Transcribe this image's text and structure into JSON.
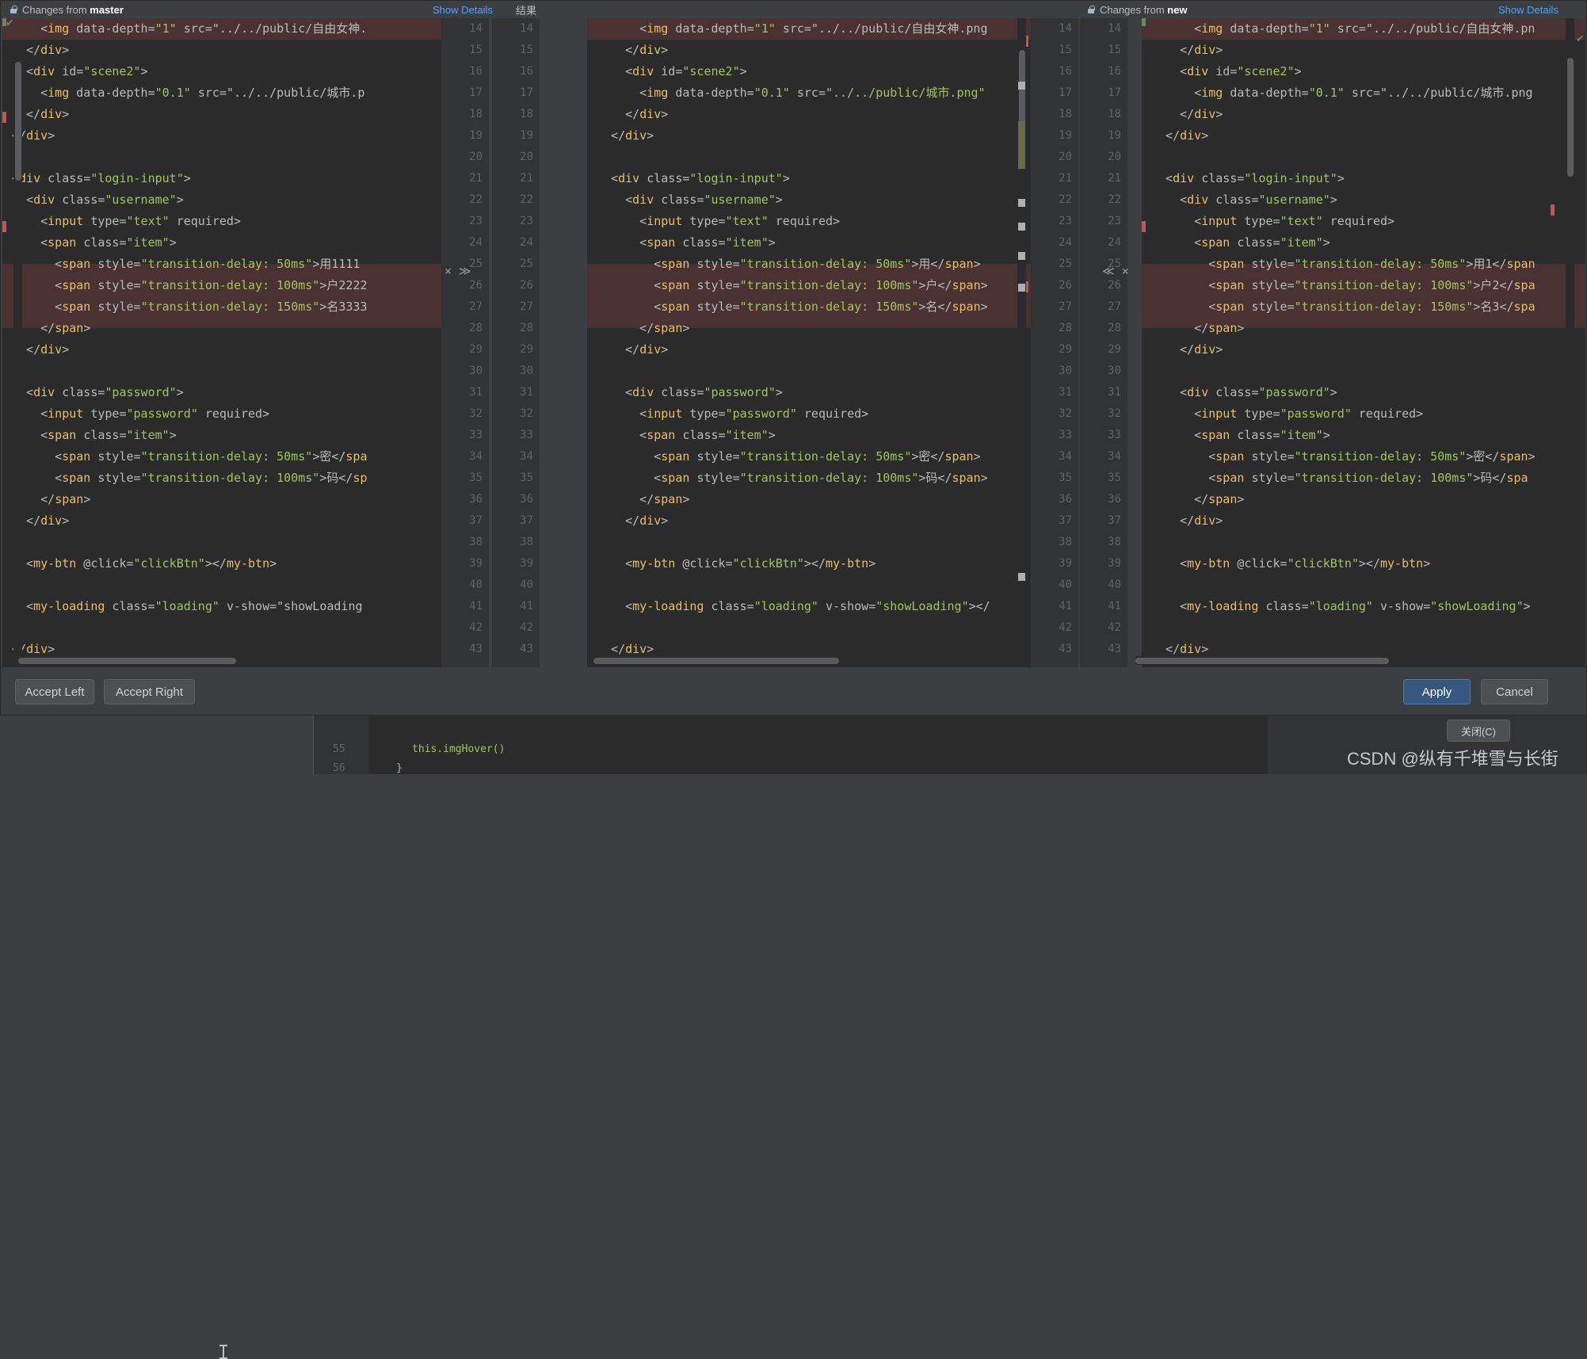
{
  "dialog": {
    "left_title_prefix": "Changes from ",
    "left_title_ref": "master",
    "right_title_prefix": "Changes from ",
    "right_title_ref": "new",
    "show_details_left": "Show Details",
    "show_details_right": "Show Details",
    "result_label": "结果",
    "buttons": {
      "accept_left": "Accept Left",
      "accept_right": "Accept Right",
      "apply": "Apply",
      "cancel": "Cancel"
    },
    "accent_primary": "#365880",
    "link_color": "#589df6"
  },
  "background": {
    "close_button": "关闭(C)",
    "watermark": "CSDN @纵有千堆雪与长街",
    "code_lines": [
      {
        "num": "55",
        "text": "this.imgHover()"
      },
      {
        "num": "56",
        "text": "}"
      }
    ]
  },
  "gutters": {
    "left_numbers": [
      "14",
      "15",
      "16",
      "17",
      "18",
      "19",
      "20",
      "21",
      "22",
      "23",
      "24",
      "25",
      "26",
      "27",
      "28",
      "29",
      "30",
      "31",
      "32",
      "33",
      "34",
      "35",
      "36",
      "37",
      "38",
      "39",
      "40",
      "41",
      "42",
      "43"
    ],
    "mid_numbers": [
      "14",
      "15",
      "16",
      "17",
      "18",
      "19",
      "20",
      "21",
      "22",
      "23",
      "24",
      "25",
      "26",
      "27",
      "28",
      "29",
      "30",
      "31",
      "32",
      "33",
      "34",
      "35",
      "36",
      "37",
      "38",
      "39",
      "40",
      "41",
      "42",
      "43"
    ],
    "right_numbers": [
      "14",
      "15",
      "16",
      "17",
      "18",
      "19",
      "20",
      "21",
      "22",
      "23",
      "24",
      "25",
      "26",
      "27",
      "28",
      "29",
      "30",
      "31",
      "32",
      "33",
      "34",
      "35",
      "36",
      "37",
      "38",
      "39",
      "40",
      "41",
      "42",
      "43"
    ],
    "left_marker": "× ≫",
    "right_marker": "≪ ×",
    "marker_line_left": "25",
    "marker_line_right": "25"
  },
  "panes": {
    "left": {
      "name": "master",
      "lines": [
        "    <img data-depth=\"1\" src=\"../../public/自由女神.",
        "  </div>",
        "  <div id=\"scene2\">",
        "    <img data-depth=\"0.1\" src=\"../../public/城市.p",
        "  </div>",
        "</div>",
        "",
        "<div class=\"login-input\">",
        "  <div class=\"username\">",
        "    <input type=\"text\" required>",
        "    <span class=\"item\">",
        "      <span style=\"transition-delay: 50ms\">用1111",
        "      <span style=\"transition-delay: 100ms\">户2222",
        "      <span style=\"transition-delay: 150ms\">名3333",
        "    </span>",
        "  </div>",
        "",
        "  <div class=\"password\">",
        "    <input type=\"password\" required>",
        "    <span class=\"item\">",
        "      <span style=\"transition-delay: 50ms\">密</spa",
        "      <span style=\"transition-delay: 100ms\">码</sp",
        "    </span>",
        "  </div>",
        "",
        "  <my-btn @click=\"clickBtn\"></my-btn>",
        "",
        "  <my-loading class=\"loading\" v-show=\"showLoading",
        "",
        "</div>"
      ]
    },
    "middle": {
      "name": "结果",
      "lines": [
        "      <img data-depth=\"1\" src=\"../../public/自由女神.png",
        "    </div>",
        "    <div id=\"scene2\">",
        "      <img data-depth=\"0.1\" src=\"../../public/城市.png\"",
        "    </div>",
        "  </div>",
        "",
        "  <div class=\"login-input\">",
        "    <div class=\"username\">",
        "      <input type=\"text\" required>",
        "      <span class=\"item\">",
        "        <span style=\"transition-delay: 50ms\">用</span>",
        "        <span style=\"transition-delay: 100ms\">户</span>",
        "        <span style=\"transition-delay: 150ms\">名</span>",
        "      </span>",
        "    </div>",
        "",
        "    <div class=\"password\">",
        "      <input type=\"password\" required>",
        "      <span class=\"item\">",
        "        <span style=\"transition-delay: 50ms\">密</span>",
        "        <span style=\"transition-delay: 100ms\">码</span>",
        "      </span>",
        "    </div>",
        "",
        "    <my-btn @click=\"clickBtn\"></my-btn>",
        "",
        "    <my-loading class=\"loading\" v-show=\"showLoading\"></",
        "",
        "  </div>"
      ]
    },
    "right": {
      "name": "new",
      "lines": [
        "      <img data-depth=\"1\" src=\"../../public/自由女神.pn",
        "    </div>",
        "    <div id=\"scene2\">",
        "      <img data-depth=\"0.1\" src=\"../../public/城市.png",
        "    </div>",
        "  </div>",
        "",
        "  <div class=\"login-input\">",
        "    <div class=\"username\">",
        "      <input type=\"text\" required>",
        "      <span class=\"item\">",
        "        <span style=\"transition-delay: 50ms\">用1</span",
        "        <span style=\"transition-delay: 100ms\">户2</spa",
        "        <span style=\"transition-delay: 150ms\">名3</spa",
        "      </span>",
        "    </div>",
        "",
        "    <div class=\"password\">",
        "      <input type=\"password\" required>",
        "      <span class=\"item\">",
        "        <span style=\"transition-delay: 50ms\">密</span>",
        "        <span style=\"transition-delay: 100ms\">码</spa",
        "      </span>",
        "    </div>",
        "",
        "    <my-btn @click=\"clickBtn\"></my-btn>",
        "",
        "    <my-loading class=\"loading\" v-show=\"showLoading\">",
        "",
        "  </div>"
      ]
    }
  }
}
